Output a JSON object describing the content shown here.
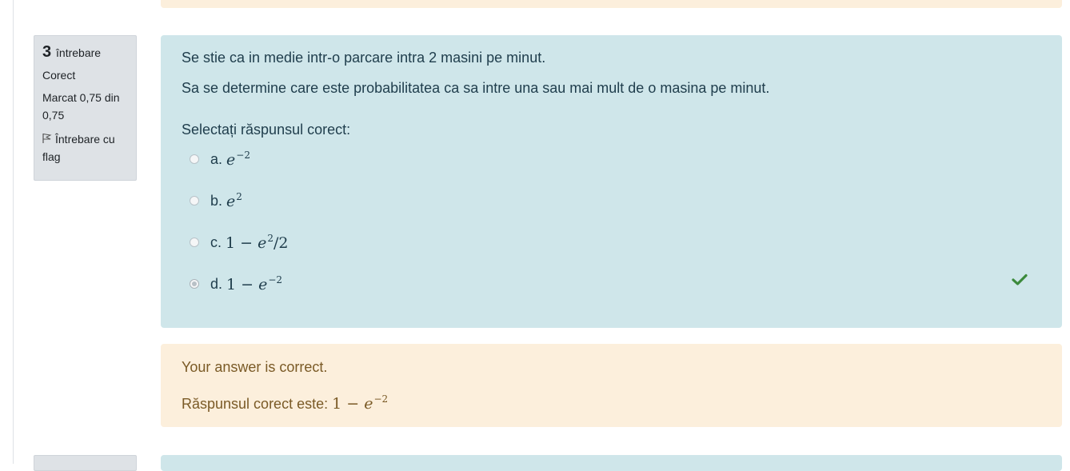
{
  "question": {
    "number": "3",
    "word": "întrebare",
    "state": "Corect",
    "grade": "Marcat 0,75 din 0,75",
    "flag_label": "Întrebare cu flag",
    "text_1": "Se stie ca in medie intr-o parcare intra 2 masini pe minut.",
    "text_2": "Sa se determine care este probabilitatea  ca sa intre una sau  mai mult de o masina pe minut.",
    "prompt": "Selectați răspunsul corect:",
    "options": [
      {
        "letter": "a.",
        "checked": false
      },
      {
        "letter": "b.",
        "checked": false
      },
      {
        "letter": "c.",
        "checked": false
      },
      {
        "letter": "d.",
        "checked": true,
        "correct": true
      }
    ]
  },
  "feedback": {
    "result": "Your answer is correct.",
    "correct_label": "Răspunsul corect este:"
  },
  "colors": {
    "formulation_bg": "#cfe6ea",
    "feedback_bg": "#fcefdc",
    "info_bg": "#dee2e6",
    "correct_check": "#3c8a3c"
  },
  "icons": [
    "flag-icon",
    "check-icon"
  ]
}
